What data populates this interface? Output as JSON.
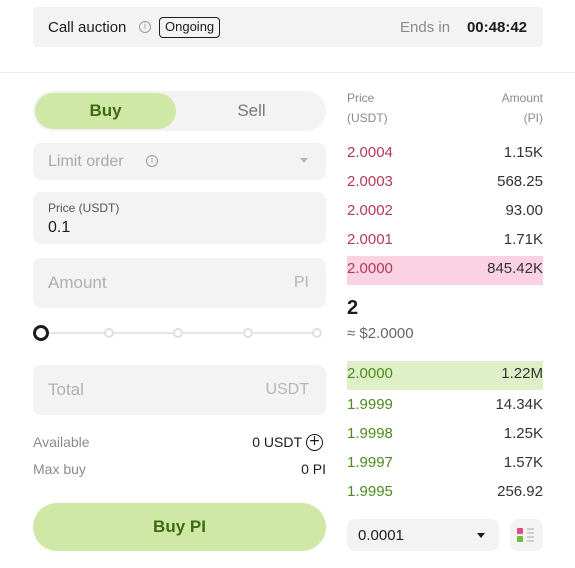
{
  "banner": {
    "title": "Call auction",
    "info_icon": "info-icon",
    "status": "Ongoing",
    "ends_label": "Ends in",
    "ends_time": "00:48:42"
  },
  "trade_form": {
    "tabs": {
      "buy": "Buy",
      "sell": "Sell",
      "active": "buy"
    },
    "order_type": "Limit order",
    "price": {
      "label": "Price (USDT)",
      "value": "0.1"
    },
    "amount": {
      "placeholder": "Amount",
      "unit": "PI"
    },
    "slider": {
      "value_percent": 0,
      "stops": 5
    },
    "total": {
      "placeholder": "Total",
      "unit": "USDT"
    },
    "available": {
      "label": "Available",
      "value": "0 USDT",
      "add_icon": "plus-circle-icon"
    },
    "max_buy": {
      "label": "Max buy",
      "value": "0 PI"
    },
    "submit_label": "Buy PI"
  },
  "order_book": {
    "header": {
      "price": "Price",
      "price_unit": "(USDT)",
      "amount": "Amount",
      "amount_unit": "(PI)"
    },
    "asks": [
      {
        "price": "2.0004",
        "amount": "1.15K"
      },
      {
        "price": "2.0003",
        "amount": "568.25"
      },
      {
        "price": "2.0002",
        "amount": "93.00"
      },
      {
        "price": "2.0001",
        "amount": "1.71K"
      },
      {
        "price": "2.0000",
        "amount": "845.42K"
      }
    ],
    "last_price": "2",
    "last_price_usd": "≈ $2.0000",
    "bids": [
      {
        "price": "2.0000",
        "amount": "1.22M"
      },
      {
        "price": "1.9999",
        "amount": "14.34K"
      },
      {
        "price": "1.9998",
        "amount": "1.25K"
      },
      {
        "price": "1.9997",
        "amount": "1.57K"
      },
      {
        "price": "1.9995",
        "amount": "256.92"
      }
    ],
    "tick_size": "0.0001",
    "layout_icon": "orderbook-layout-icon"
  },
  "colors": {
    "buy_accent": "#cfe8a6",
    "buy_text": "#3d6b12",
    "ask_text": "#b13a59",
    "ask_highlight": "#fbd2e2",
    "bid_text": "#4e8a1e",
    "bid_highlight": "#dff0c8"
  }
}
